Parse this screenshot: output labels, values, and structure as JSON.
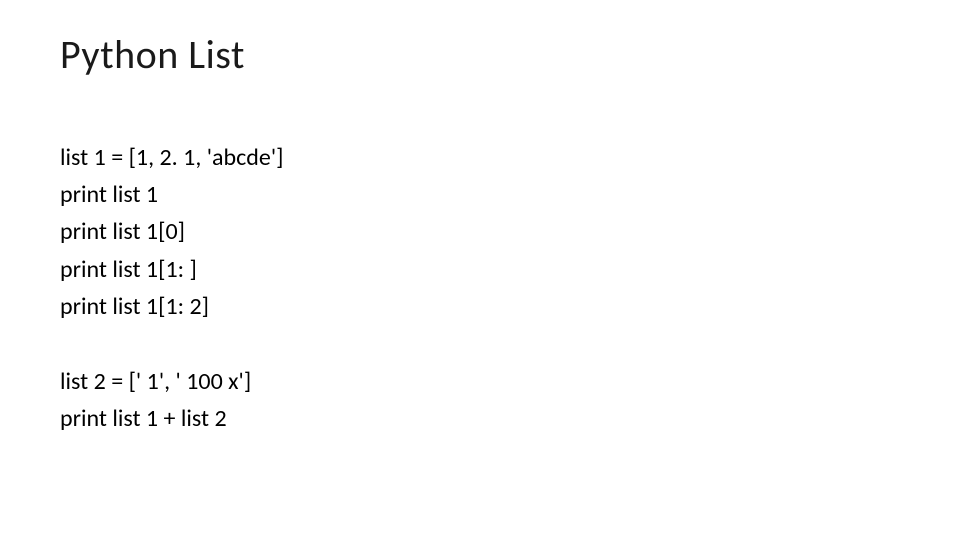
{
  "title": "Python List",
  "block1": {
    "line1": "list 1 = [1, 2. 1, 'abcde']",
    "line2": "print list 1",
    "line3": "print list 1[0]",
    "line4": "print list 1[1: ]",
    "line5": "print list 1[1: 2]"
  },
  "block2": {
    "line1": "list 2 = [' 1', ' 100 x']",
    "line2": "print list 1 + list 2"
  }
}
